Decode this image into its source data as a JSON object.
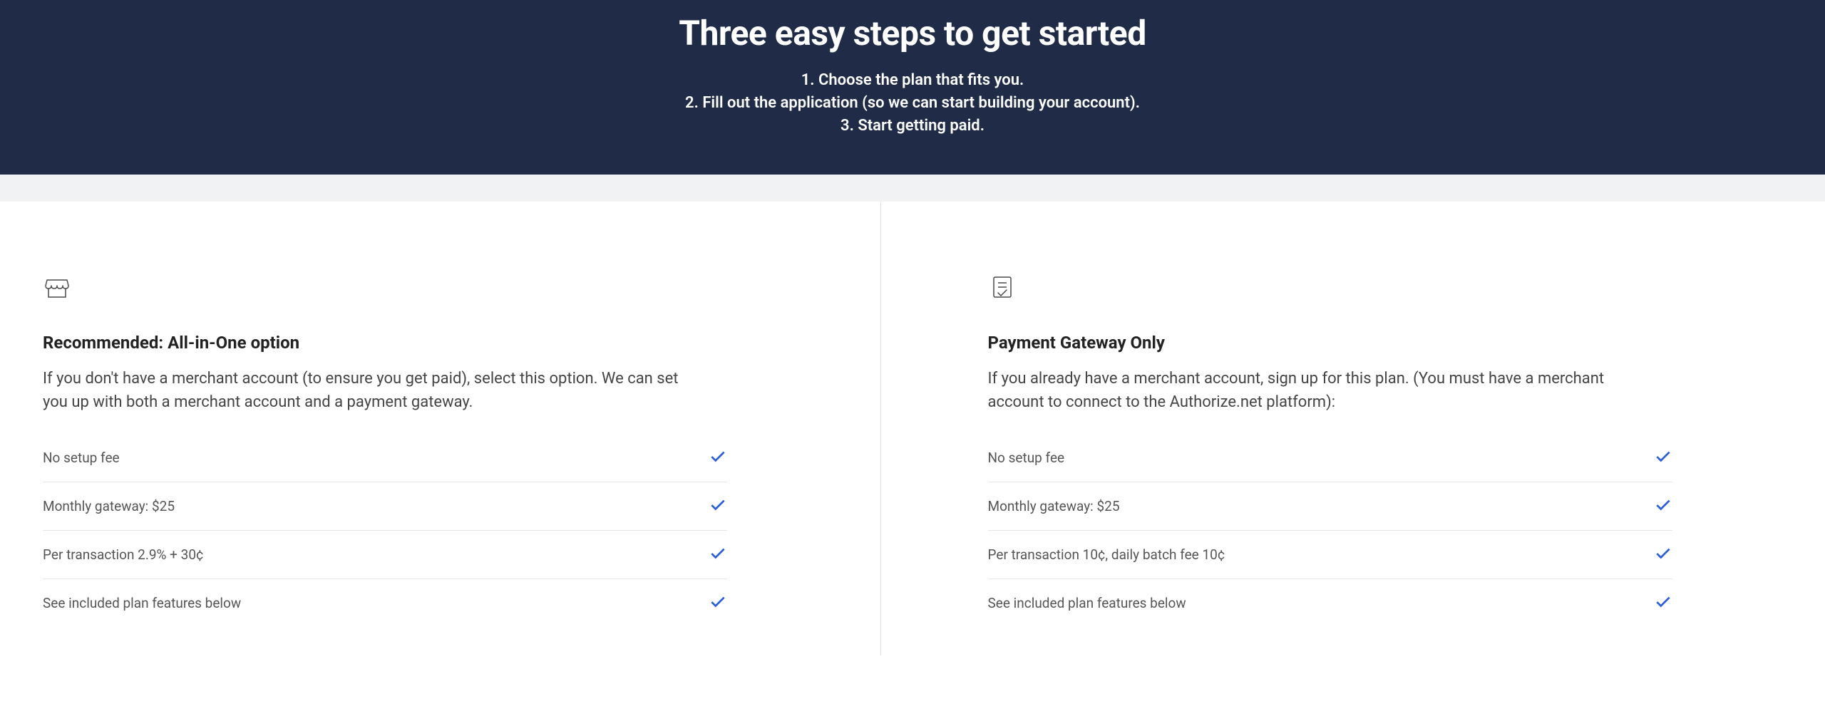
{
  "hero": {
    "title": "Three easy steps to get started",
    "step1": "1. Choose the plan that fits you.",
    "step2": "2. Fill out the application (so we can start building your account).",
    "step3": "3. Start getting paid."
  },
  "plans": {
    "allInOne": {
      "title": "Recommended: All-in-One option",
      "description": "If you don't have a merchant account (to ensure you get paid), select this option. We can set you up with both a merchant account and a payment gateway.",
      "features": {
        "0": "No setup fee",
        "1": "Monthly gateway: $25",
        "2": "Per transaction 2.9% + 30¢",
        "3": "See included plan features below"
      }
    },
    "gatewayOnly": {
      "title": "Payment Gateway Only",
      "description": "If you already have a merchant account, sign up for this plan. (You must have a merchant account to connect to the Authorize.net platform):",
      "features": {
        "0": "No setup fee",
        "1": "Monthly gateway: $25",
        "2": "Per transaction 10¢, daily batch fee 10¢",
        "3": "See included plan features below"
      }
    }
  }
}
